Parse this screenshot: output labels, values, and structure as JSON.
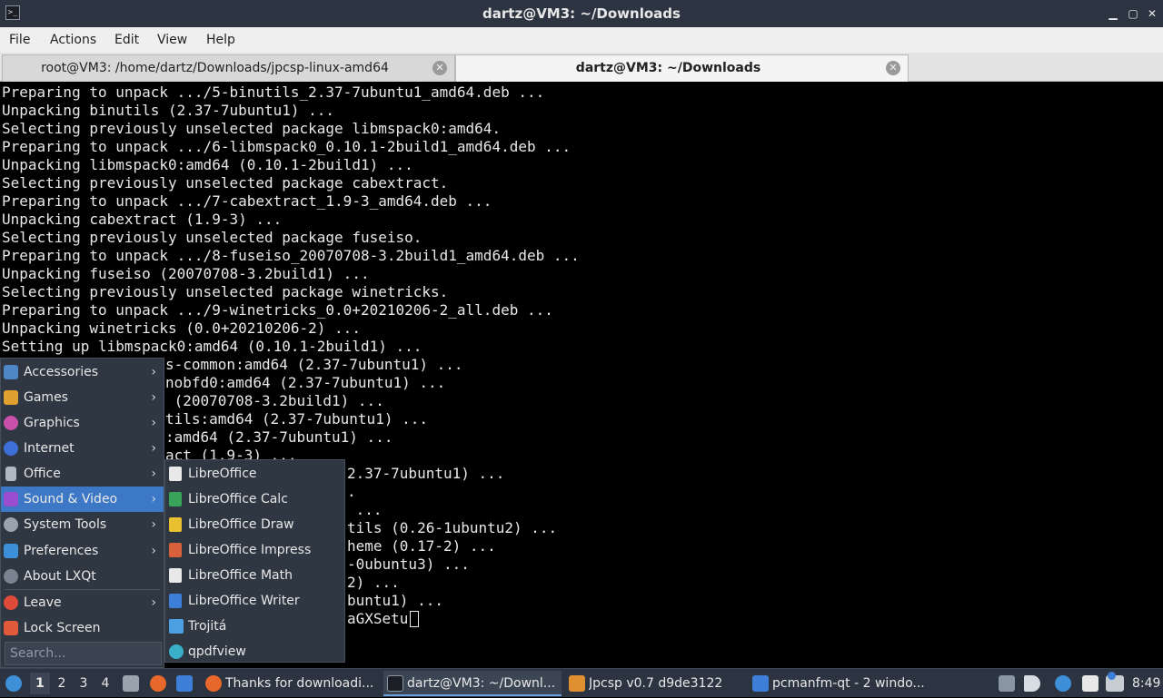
{
  "window": {
    "title": "dartz@VM3: ~/Downloads",
    "app_icon_glyph": ">_",
    "minimize_glyph": "▁",
    "maximize_glyph": "▢",
    "close_glyph": "✕"
  },
  "menubar": {
    "items": [
      "File",
      "Actions",
      "Edit",
      "View",
      "Help"
    ]
  },
  "tabs": [
    {
      "label": "root@VM3: /home/dartz/Downloads/jpcsp-linux-amd64",
      "active": false
    },
    {
      "label": "dartz@VM3: ~/Downloads",
      "active": true
    }
  ],
  "tab_close_glyph": "✕",
  "terminal": {
    "lines": [
      "Preparing to unpack .../5-binutils_2.37-7ubuntu1_amd64.deb ...",
      "Unpacking binutils (2.37-7ubuntu1) ...",
      "Selecting previously unselected package libmspack0:amd64.",
      "Preparing to unpack .../6-libmspack0_0.10.1-2build1_amd64.deb ...",
      "Unpacking libmspack0:amd64 (0.10.1-2build1) ...",
      "Selecting previously unselected package cabextract.",
      "Preparing to unpack .../7-cabextract_1.9-3_amd64.deb ...",
      "Unpacking cabextract (1.9-3) ...",
      "Selecting previously unselected package fuseiso.",
      "Preparing to unpack .../8-fuseiso_20070708-3.2build1_amd64.deb ...",
      "Unpacking fuseiso (20070708-3.2build1) ...",
      "Selecting previously unselected package winetricks.",
      "Preparing to unpack .../9-winetricks_0.0+20210206-2_all.deb ...",
      "Unpacking winetricks (0.0+20210206-2) ...",
      "Setting up libmspack0:amd64 (0.10.1-2build1) ...",
      "Setting up binutils-common:amd64 (2.37-7ubuntu1) ...",
      "Setting up libctf-nobfd0:amd64 (2.37-7ubuntu1) ...",
      "Setting up fuseiso (20070708-3.2build1) ...",
      "Setting up binutils:amd64 (2.37-7ubuntu1) ...",
      "Setting up libctf0:amd64 (2.37-7ubuntu1) ...",
      "Setting up cabextract (1.9-3) ...",
      "Setting up binutils-x86-64-linux-gnu (2.37-7ubuntu1) ...",
      "Setting up winetricks (0.0+20210206-2) ...",
      "Processing triggers for man-db ...",
      "Processing triggers for desktop-file-utils (0.26-1ubuntu2) ...",
      "Processing triggers for hicolor-icon-theme (0.17-2) ...",
      "Processing triggers for mailcap (3.70+nmu1ubuntu1) ...",
      "Processing triggers for libc-bin (2.35-0ubuntu3) ...",
      "Processing triggers for gnome-menus (3.36.0-1ubuntu1) ...",
      "dartz@VM3:~/Downloads$ ./ModernaGXSetu"
    ],
    "visible_fragments": [
      "s-common:amd64 (2.37-7ubuntu1) ...",
      "nobfd0:amd64 (2.37-7ubuntu1) ...",
      " (20070708-3.2build1) ...",
      "tils:amd64 (2.37-7ubuntu1) ...",
      ":amd64 (2.37-7ubuntu1) ...",
      "act (1.9-3) ...",
      "2.37-7ubuntu1) ...",
      ".",
      " ...",
      "tils (0.26-1ubuntu2) ...",
      "heme (0.17-2) ...",
      "-0ubuntu3) ...",
      "2) ...",
      "buntu1) ...",
      "aGXSetu"
    ]
  },
  "start_menu": {
    "items": [
      {
        "label": "Accessories",
        "submenu": true,
        "icon": "accessories-icon",
        "color": "#4f86c6"
      },
      {
        "label": "Games",
        "submenu": true,
        "icon": "games-icon",
        "color": "#e0a030"
      },
      {
        "label": "Graphics",
        "submenu": true,
        "icon": "graphics-icon",
        "color": "#c850a8"
      },
      {
        "label": "Internet",
        "submenu": true,
        "icon": "internet-icon",
        "color": "#3d6fd8"
      },
      {
        "label": "Office",
        "submenu": true,
        "icon": "office-icon",
        "color": "#b0b8c4"
      },
      {
        "label": "Sound & Video",
        "submenu": true,
        "icon": "sound-video-icon",
        "color": "#9b4dd0",
        "highlighted": true
      },
      {
        "label": "System Tools",
        "submenu": true,
        "icon": "system-tools-icon",
        "color": "#9aa3ad"
      },
      {
        "label": "Preferences",
        "submenu": true,
        "icon": "preferences-icon",
        "color": "#3d8fd8"
      },
      {
        "label": "About LXQt",
        "submenu": false,
        "icon": "about-icon",
        "color": "#7a8490"
      },
      {
        "label": "Leave",
        "submenu": true,
        "icon": "power-icon",
        "color": "#e04a3a"
      },
      {
        "label": "Lock Screen",
        "submenu": false,
        "icon": "lock-icon",
        "color": "#e05a3a"
      }
    ],
    "arrow_glyph": "›",
    "search_placeholder": "Search..."
  },
  "office_submenu": {
    "items": [
      {
        "label": "LibreOffice",
        "icon": "libreoffice-icon",
        "color": "#e8e8e8"
      },
      {
        "label": "LibreOffice Calc",
        "icon": "libreoffice-calc-icon",
        "color": "#3aa35a"
      },
      {
        "label": "LibreOffice Draw",
        "icon": "libreoffice-draw-icon",
        "color": "#e8c030"
      },
      {
        "label": "LibreOffice Impress",
        "icon": "libreoffice-impress-icon",
        "color": "#d8603a"
      },
      {
        "label": "LibreOffice Math",
        "icon": "libreoffice-math-icon",
        "color": "#e8e8e8"
      },
      {
        "label": "LibreOffice Writer",
        "icon": "libreoffice-writer-icon",
        "color": "#3d7fd8"
      },
      {
        "label": "Trojitá",
        "icon": "trojita-icon",
        "color": "#4aa0e0"
      },
      {
        "label": "qpdfview",
        "icon": "qpdfview-icon",
        "color": "#3ab0c8"
      }
    ]
  },
  "taskbar": {
    "desktops": [
      "1",
      "2",
      "3",
      "4"
    ],
    "active_desktop": "1",
    "tasks": [
      {
        "label": "Thanks for downloadi...",
        "icon": "firefox-icon",
        "color": "#e8672a",
        "active": false
      },
      {
        "label": "dartz@VM3: ~/Downl...",
        "icon": "terminal-icon",
        "color": "#1b1f25",
        "active": true
      },
      {
        "label": "Jpcsp v0.7 d9de3122",
        "icon": "jpcsp-icon",
        "color": "#e09030",
        "active": false
      },
      {
        "label": "pcmanfm-qt - 2 windo...",
        "icon": "folder-icon",
        "color": "#3d7fd8",
        "active": false
      }
    ],
    "clock": "8:49"
  }
}
